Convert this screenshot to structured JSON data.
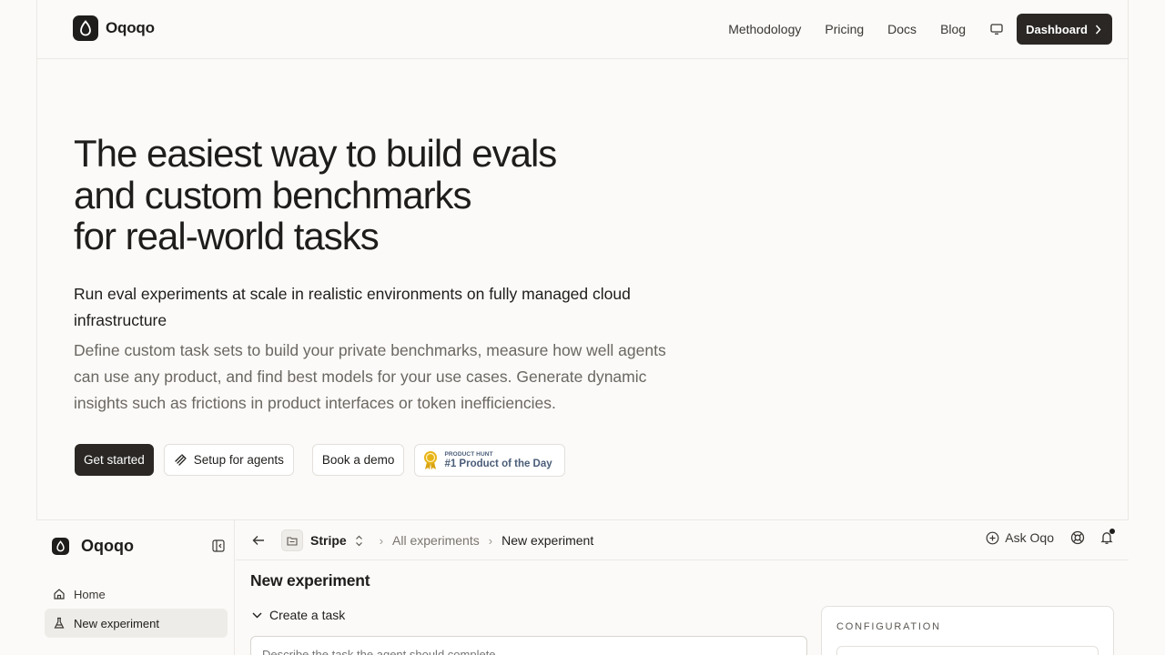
{
  "nav": {
    "brand": "Oqoqo",
    "links": [
      "Methodology",
      "Pricing",
      "Docs",
      "Blog"
    ],
    "dashboard_label": "Dashboard"
  },
  "hero": {
    "title_lines": [
      "The easiest way to build evals",
      "and custom benchmarks",
      "for real-world tasks"
    ],
    "subtitle": "Run eval experiments at scale in realistic environments on fully managed cloud infrastructure",
    "description": "Define custom task sets to build your private benchmarks, measure how well agents can use any product, and find best models for your use cases. Generate dynamic insights such as frictions in product interfaces or token inefficiencies.",
    "cta_primary": "Get started",
    "cta_agents": "Setup for agents",
    "cta_demo": "Book a demo",
    "badge_small": "PRODUCT HUNT",
    "badge_big": "#1 Product of the Day"
  },
  "app": {
    "brand": "Oqoqo",
    "sidebar_items": [
      "Home",
      "New experiment"
    ],
    "breadcrumb": {
      "project": "Stripe",
      "all": "All experiments",
      "current": "New experiment"
    },
    "ask_label": "Ask Oqo",
    "page_title": "New experiment",
    "section_label": "Create a task",
    "task_placeholder": "Describe the task the agent should complete",
    "config_label": "CONFIGURATION"
  },
  "colors": {
    "background": "#fbfaf8",
    "primary_dark": "#2a2724",
    "badge_text": "#4a5d78",
    "medal": "#e7b416"
  }
}
